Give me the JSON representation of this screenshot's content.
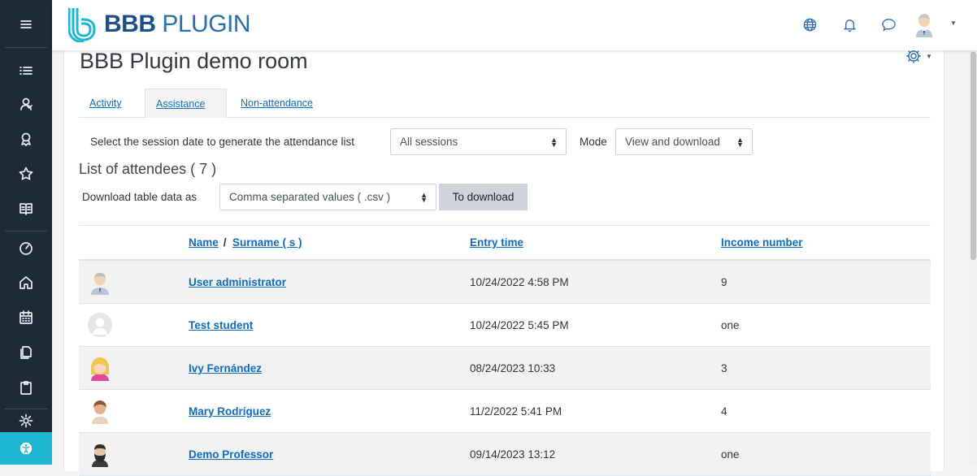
{
  "brand": {
    "name_bold": "BBB",
    "name_light": "PLUGIN"
  },
  "page": {
    "title": "BBB Plugin demo room"
  },
  "tabs": [
    {
      "label": "Activity"
    },
    {
      "label": "Assistance"
    },
    {
      "label": "Non-attendance"
    }
  ],
  "filters": {
    "session_label": "Select the session date to generate the attendance list",
    "session_value": "All sessions",
    "mode_label": "Mode",
    "mode_value": "View and download"
  },
  "attendees": {
    "heading": "List of attendees ( 7 )",
    "download_label": "Download table data as",
    "format_value": "Comma separated values ( .csv )",
    "download_button": "To download"
  },
  "table": {
    "headers": {
      "name": "Name",
      "sep": " / ",
      "surname": "Surname ( s )",
      "entry": "Entry time",
      "income": "Income number"
    },
    "rows": [
      {
        "name": "User administrator",
        "entry": "10/24/2022 4:58 PM",
        "income": "9",
        "avatar": "admin"
      },
      {
        "name": "Test student",
        "entry": "10/24/2022 5:45 PM",
        "income": "one",
        "avatar": "default"
      },
      {
        "name": "Ivy Fernández",
        "entry": "08/24/2023 10:33",
        "income": "3",
        "avatar": "girl"
      },
      {
        "name": "Mary Rodríguez",
        "entry": "11/2/2022 5:41 PM",
        "income": "4",
        "avatar": "woman"
      },
      {
        "name": "Demo Professor",
        "entry": "09/14/2023 13:12",
        "income": "one",
        "avatar": "bearded"
      }
    ]
  },
  "colors": {
    "sidebar": "#1e2a35",
    "accent": "#1db5cf",
    "link": "#0f6cbf"
  }
}
